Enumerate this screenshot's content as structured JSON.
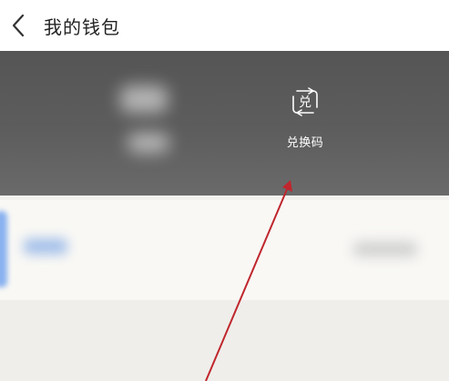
{
  "header": {
    "title": "我的钱包",
    "back_icon": "chevron-left-icon"
  },
  "banner": {
    "redeem_label": "兑换码",
    "redeem_icon_glyph": "兑",
    "redeem_icon": "redeem-exchange-icon"
  },
  "colors": {
    "header_bg": "#ffffff",
    "banner_bg": "#5a5a5a",
    "arrow": "#c0262d",
    "card_accent": "#8ab2ef"
  }
}
